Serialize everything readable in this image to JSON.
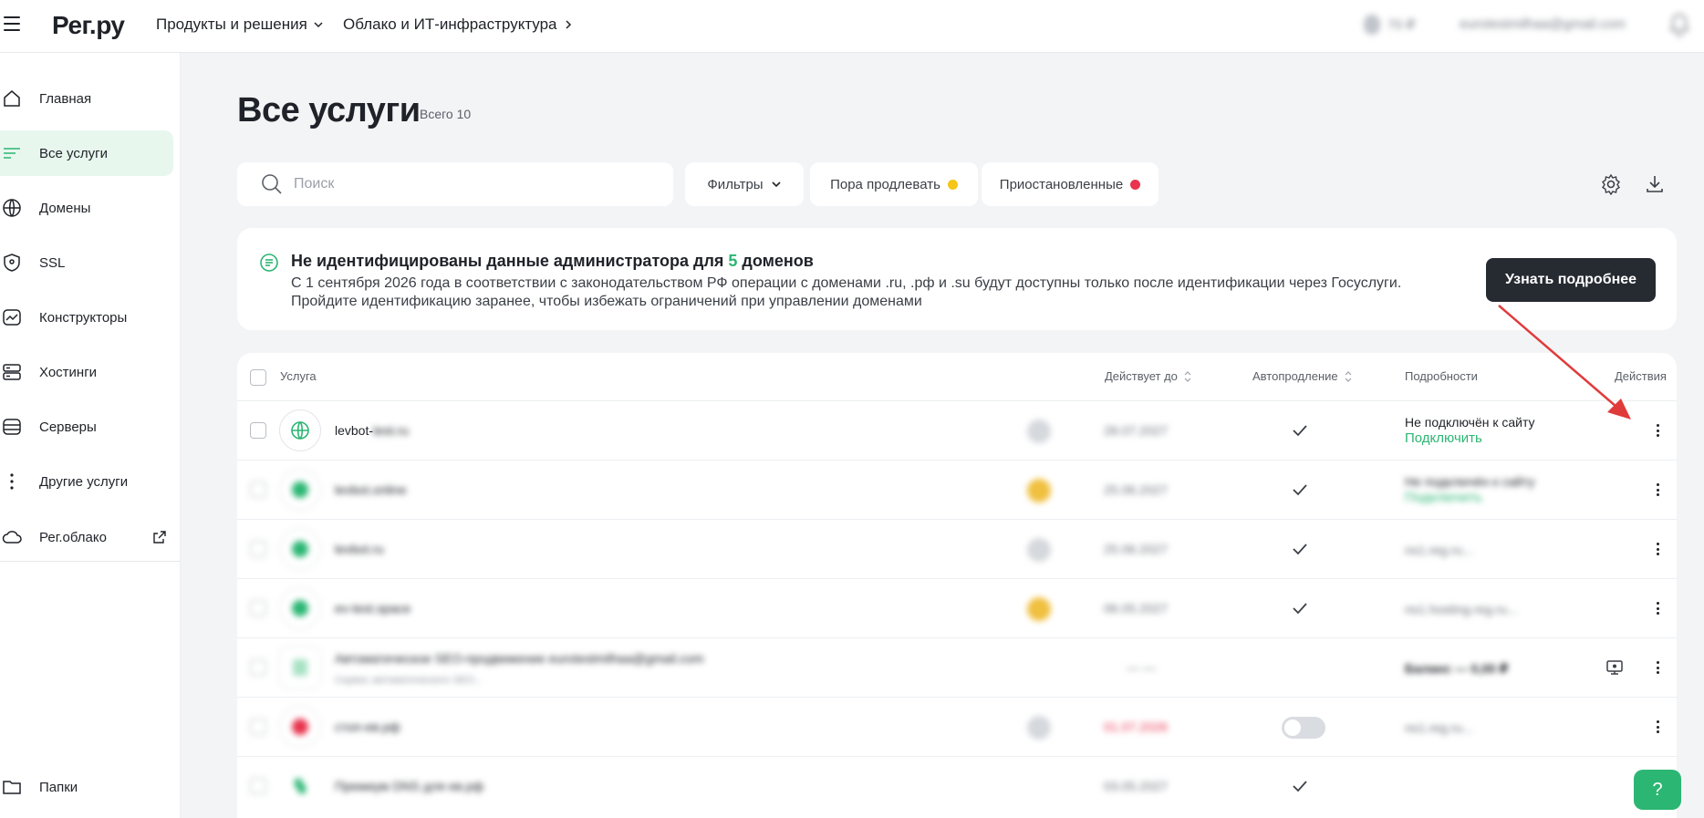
{
  "header": {
    "logo": "Рег.ру",
    "nav": [
      {
        "label": "Продукты и решения"
      },
      {
        "label": "Облако и ИТ-инфраструктура"
      }
    ],
    "balance": "70 ₽",
    "email": "eurotestmilhaa@gmail.com"
  },
  "sidebar": {
    "items": [
      {
        "label": "Главная"
      },
      {
        "label": "Все услуги"
      },
      {
        "label": "Домены"
      },
      {
        "label": "SSL"
      },
      {
        "label": "Конструкторы"
      },
      {
        "label": "Хостинги"
      },
      {
        "label": "Серверы"
      },
      {
        "label": "Другие услуги"
      },
      {
        "label": "Рег.облако"
      },
      {
        "label": "Папки"
      }
    ]
  },
  "page": {
    "title": "Все услуги",
    "total": "Всего 10"
  },
  "toolbar": {
    "search_placeholder": "Поиск",
    "filters": "Фильтры",
    "renew": "Пора продлевать",
    "suspended": "Приостановленные"
  },
  "banner": {
    "title_pre": "Не идентифицированы данные администратора для ",
    "title_count": "5",
    "title_post": " доменов",
    "line1": "С 1 сентября 2026 года в соответствии с законодательством РФ операции с доменами .ru, .рф и .su будут доступны только после идентификации через Госуслуги.",
    "line2": "Пройдите идентификацию заранее, чтобы избежать ограничений при управлении доменами",
    "button": "Узнать подробнее"
  },
  "table": {
    "headers": {
      "service": "Услуга",
      "valid_until": "Действует до",
      "autorenew": "Автопродление",
      "details": "Подробности",
      "actions": "Действия"
    },
    "rows": [
      {
        "name_clear": "levbot-",
        "name_blur": "test.ru",
        "date": "28.07.2027",
        "auto": "check",
        "det1": "Не подключён к сайту",
        "det2": "Подключить",
        "blurred": false
      },
      {
        "name_clear": "",
        "name_blur": "levbot.online",
        "date": "25.06.2027",
        "auto": "check",
        "det1": "Не подключён к сайту",
        "det2": "Подключить",
        "blurred": true
      },
      {
        "name_clear": "",
        "name_blur": "levbot.ru",
        "date": "25.06.2027",
        "auto": "check",
        "det1": "ns1.reg.ru...",
        "det2": "",
        "blurred": true
      },
      {
        "name_clear": "",
        "name_blur": "ev-test.space",
        "date": "06.05.2027",
        "auto": "check",
        "det1": "ns1.hosting.reg.ru...",
        "det2": "",
        "blurred": true
      },
      {
        "name_clear": "",
        "name_blur": "Автоматическое SEO-продвижение eurotestmilhaa@gmail.com",
        "sub": "Сервис автоматического SEO...",
        "date": "— —",
        "auto": "",
        "det1": "Баланс — 0,00 ₽",
        "det2": "",
        "blurred": true
      },
      {
        "name_clear": "",
        "name_blur": "стоп-ев.рф",
        "date": "01.07.2026",
        "auto": "toggle",
        "det1": "ns1.reg.ru...",
        "det2": "",
        "blurred": true
      },
      {
        "name_clear": "",
        "name_blur": "Премиум DNS для ев.рф",
        "date": "03.05.2027",
        "auto": "check",
        "det1": "",
        "det2": "",
        "blurred": true
      }
    ]
  },
  "help_label": "?",
  "colors": {
    "accent": "#2bb673",
    "warn": "#f5c518",
    "danger": "#e8344e",
    "arrow": "#e03b3b"
  }
}
